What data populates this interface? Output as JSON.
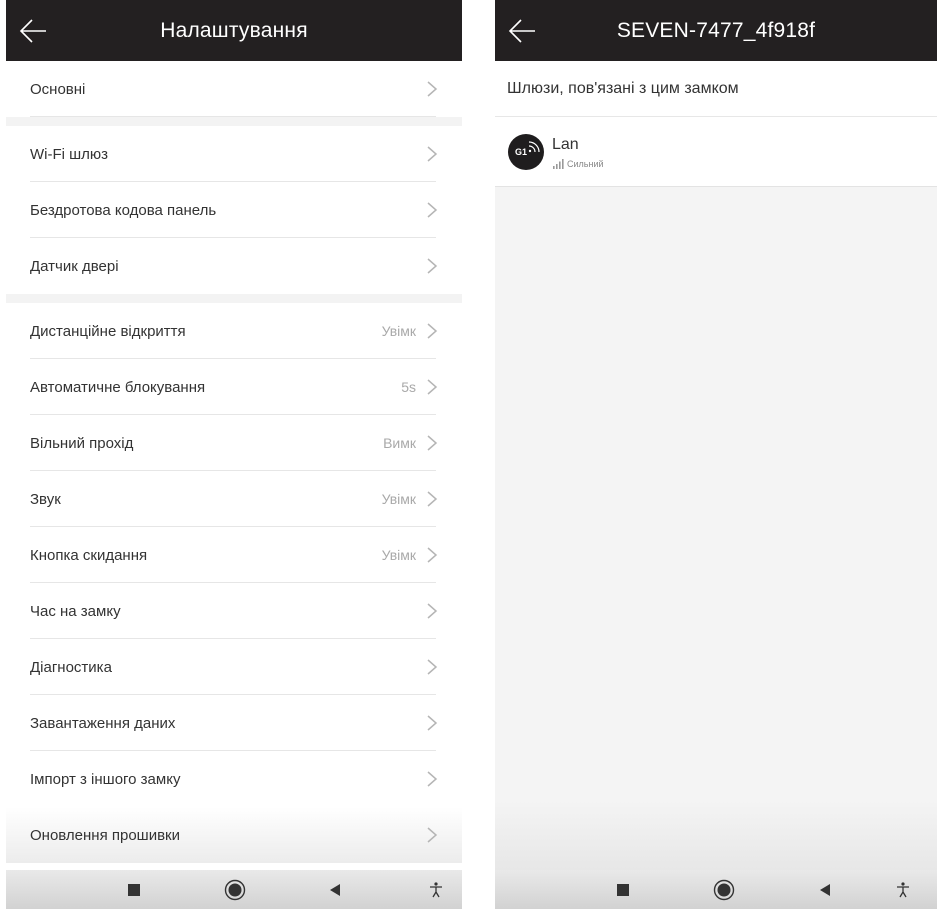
{
  "left": {
    "title": "Налаштування",
    "rows": [
      {
        "label": "Основні",
        "value": ""
      },
      {
        "label": "Wi-Fi шлюз",
        "value": ""
      },
      {
        "label": "Бездротова кодова панель",
        "value": ""
      },
      {
        "label": "Датчик двері",
        "value": ""
      },
      {
        "label": "Дистанційне відкриття",
        "value": "Увімк"
      },
      {
        "label": "Автоматичне блокування",
        "value": "5s"
      },
      {
        "label": "Вільний прохід",
        "value": "Вимк"
      },
      {
        "label": "Звук",
        "value": "Увімк"
      },
      {
        "label": "Кнопка скидання",
        "value": "Увімк"
      },
      {
        "label": "Час на замку",
        "value": ""
      },
      {
        "label": "Діагностика",
        "value": ""
      },
      {
        "label": "Завантаження даних",
        "value": ""
      },
      {
        "label": "Імпорт з іншого замку",
        "value": ""
      },
      {
        "label": "Оновлення прошивки",
        "value": ""
      }
    ]
  },
  "right": {
    "title": "SEVEN-7477_4f918f",
    "section_header": "Шлюзи, пов'язані з цим замком",
    "gateway": {
      "avatar_text": "G1",
      "name": "Lan",
      "signal_label": "Сильний"
    }
  },
  "icons": {
    "back": "back-arrow-icon",
    "chevron": "chevron-right-icon",
    "nav_square": "square-nav-icon",
    "nav_home": "home-circle-icon",
    "nav_back": "triangle-back-icon",
    "nav_accessibility": "accessibility-icon",
    "gateway": "gateway-wifi-icon",
    "signal": "signal-bars-icon"
  },
  "colors": {
    "titlebar": "#232021",
    "background": "#ffffff",
    "muted_text": "#a9a9a9"
  }
}
